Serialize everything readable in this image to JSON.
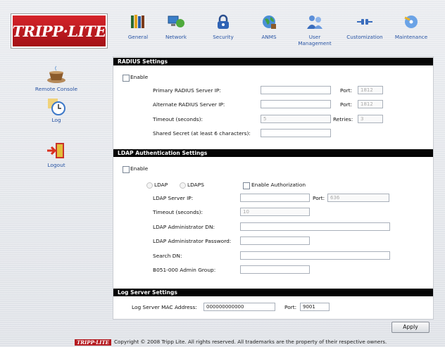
{
  "brand": {
    "logo_text": "TRIPP·LITE",
    "footer_logo_text": "TRIPP·LITE"
  },
  "top_nav": [
    {
      "label": "General",
      "icon": "books-icon"
    },
    {
      "label": "Network",
      "icon": "network-icon"
    },
    {
      "label": "Security",
      "icon": "lock-icon"
    },
    {
      "label": "ANMS",
      "icon": "globe-icon"
    },
    {
      "label": "User\nManagement",
      "icon": "users-icon"
    },
    {
      "label": "Customization",
      "icon": "plug-icon"
    },
    {
      "label": "Maintenance",
      "icon": "disc-icon"
    }
  ],
  "side_nav": [
    {
      "label": "Remote Console",
      "icon": "coffee-cup-icon"
    },
    {
      "label": "Log",
      "icon": "clock-icon"
    },
    {
      "label": "Logout",
      "icon": "exit-door-icon"
    }
  ],
  "radius": {
    "title": "RADIUS Settings",
    "enable_label": "Enable",
    "primary_ip_label": "Primary RADIUS Server IP:",
    "primary_ip_value": "",
    "primary_port_label": "Port:",
    "primary_port_value": "1812",
    "alternate_ip_label": "Alternate RADIUS Server IP:",
    "alternate_ip_value": "",
    "alternate_port_label": "Port:",
    "alternate_port_value": "1812",
    "timeout_label": "Timeout (seconds):",
    "timeout_value": "5",
    "retries_label": "Retries:",
    "retries_value": "3",
    "secret_label": "Shared Secret (at least 6 characters):",
    "secret_value": ""
  },
  "ldap": {
    "title": "LDAP Authentication Settings",
    "enable_label": "Enable",
    "option_ldap": "LDAP",
    "option_ldaps": "LDAPS",
    "enable_authorization_label": "Enable Authorization",
    "server_ip_label": "LDAP Server IP:",
    "server_ip_value": "",
    "port_label": "Port:",
    "port_value": "636",
    "timeout_label": "Timeout (seconds):",
    "timeout_value": "10",
    "admin_dn_label": "LDAP Administrator DN:",
    "admin_dn_value": "",
    "admin_password_label": "LDAP Administrator Password:",
    "admin_password_value": "",
    "search_dn_label": "Search DN:",
    "search_dn_value": "",
    "admin_group_label": "B051-000 Admin Group:",
    "admin_group_value": ""
  },
  "log_server": {
    "title": "Log Server Settings",
    "mac_label": "Log Server MAC Address:",
    "mac_value": "000000000000",
    "port_label": "Port:",
    "port_value": "9001"
  },
  "apply_label": "Apply",
  "footer_text": "Copyright © 2008 Tripp Lite. All rights reserved. All trademarks are the property of their respective owners.",
  "colors": {
    "nav_link": "#2854a4",
    "section_header": "#050505",
    "brand_red": "#c41e24"
  }
}
